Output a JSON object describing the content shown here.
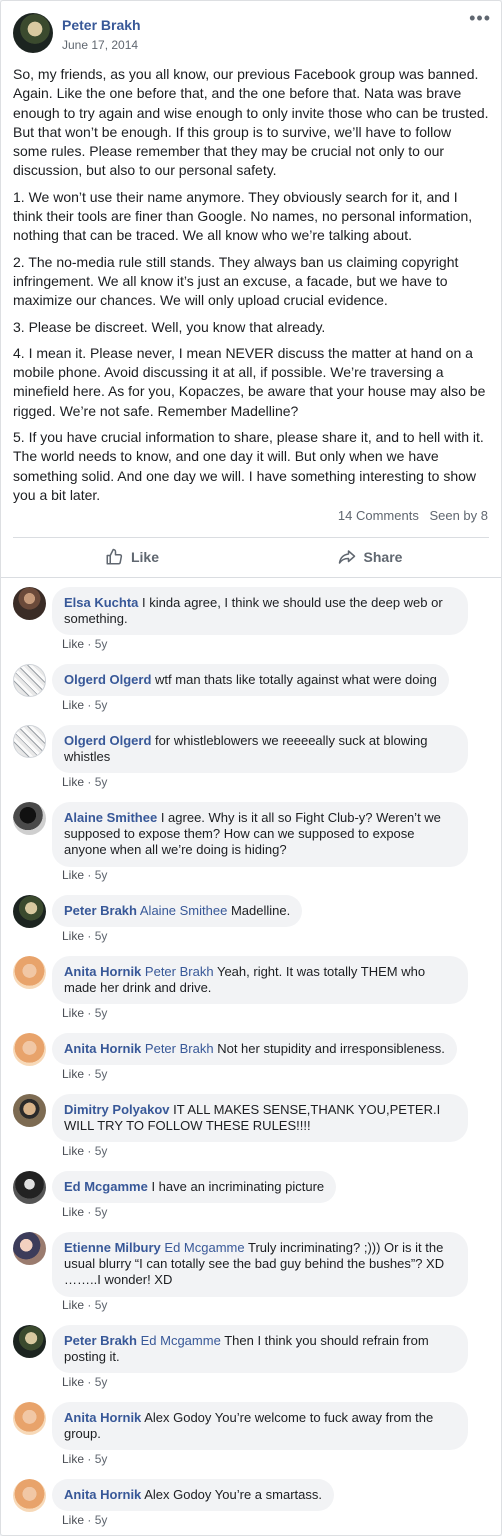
{
  "post": {
    "author": "Peter Brakh",
    "date": "June 17, 2014",
    "more_icon": "more-horizontal-icon",
    "paragraphs": [
      "So, my friends, as you all know, our previous Facebook group was banned. Again. Like the one before that, and the one before that. Nata was brave enough to try again and wise enough to only invite those who can be trusted. But that won’t be enough. If this group is to survive, we’ll have to follow some rules. Please remember that they may be crucial not only to our discussion, but also to our personal safety.",
      "1. We won’t use their name anymore. They obviously search for it, and I think their tools are finer than Google. No names, no personal information, nothing that can be traced. We all know who we’re talking about.",
      "2. The no-media rule still stands. They always ban us claiming copyright infringement. We all know it’s just an excuse, a facade, but we have to maximize our chances. We will only upload crucial evidence.",
      "3. Please be discreet. Well, you know that already.",
      "4. I mean it. Please never, I mean NEVER discuss the matter at hand on a mobile phone. Avoid discussing it at all, if possible. We’re traversing a minefield here. As for you, Kopaczes, be aware that your house may also be rigged. We’re not safe. Remember Madelline?",
      "5. If you have crucial information to share, please share it, and to hell with it. The world needs to know, and one day it will. But only when we have something solid. And one day we will. I have something interesting to show you a bit later."
    ],
    "comments_count": "14 Comments",
    "seen_by": "Seen by 8",
    "like_label": "Like",
    "share_label": "Share"
  },
  "comments": [
    {
      "author": "Elsa Kuchta",
      "mention": "",
      "text": "I kinda agree, I think we should use the deep web or something.",
      "like": "Like",
      "time": "5y"
    },
    {
      "author": "Olgerd Olgerd",
      "mention": "",
      "text": "wtf man thats like totally against what were doing",
      "like": "Like",
      "time": "5y"
    },
    {
      "author": "Olgerd Olgerd",
      "mention": "",
      "text": "for whistleblowers we reeeeally suck at blowing whistles",
      "like": "Like",
      "time": "5y"
    },
    {
      "author": "Alaine Smithee",
      "mention": "",
      "text": "I agree. Why is it all so Fight Club-y? Weren’t we supposed to expose them? How can we supposed to expose anyone when all we’re doing is hiding?",
      "like": "Like",
      "time": "5y"
    },
    {
      "author": "Peter Brakh",
      "mention": "Alaine Smithee",
      "text": "Madelline.",
      "like": "Like",
      "time": "5y"
    },
    {
      "author": "Anita Hornik",
      "mention": "Peter Brakh",
      "text": "Yeah, right. It was totally THEM who made her drink and drive.",
      "like": "Like",
      "time": "5y"
    },
    {
      "author": "Anita Hornik",
      "mention": "Peter Brakh",
      "text": "Not her stupidity and irresponsibleness.",
      "like": "Like",
      "time": "5y"
    },
    {
      "author": "Dimitry Polyakov",
      "mention": "",
      "text": "IT ALL MAKES SENSE,THANK YOU,PETER.I WILL TRY TO FOLLOW THESE RULES!!!!",
      "like": "Like",
      "time": "5y"
    },
    {
      "author": "Ed Mcgamme",
      "mention": "",
      "text": "I have an incriminating picture",
      "like": "Like",
      "time": "5y"
    },
    {
      "author": "Etienne Milbury",
      "mention": "Ed Mcgamme",
      "text": "Truly incriminating? ;))) Or is it the usual blurry “I can totally see the bad guy behind the bushes”? XD ……..I wonder! XD",
      "like": "Like",
      "time": "5y"
    },
    {
      "author": "Peter Brakh",
      "mention": "Ed Mcgamme",
      "text": "Then I think you should refrain from posting it.",
      "like": "Like",
      "time": "5y"
    },
    {
      "author": "Anita Hornik",
      "mention": "Alex Godoy",
      "text": "You’re welcome to fuck away from the group.",
      "like": "Like",
      "time": "5y"
    },
    {
      "author": "Anita Hornik",
      "mention": "Alex Godoy",
      "text": "You’re a smartass.",
      "like": "Like",
      "time": "5y"
    }
  ]
}
